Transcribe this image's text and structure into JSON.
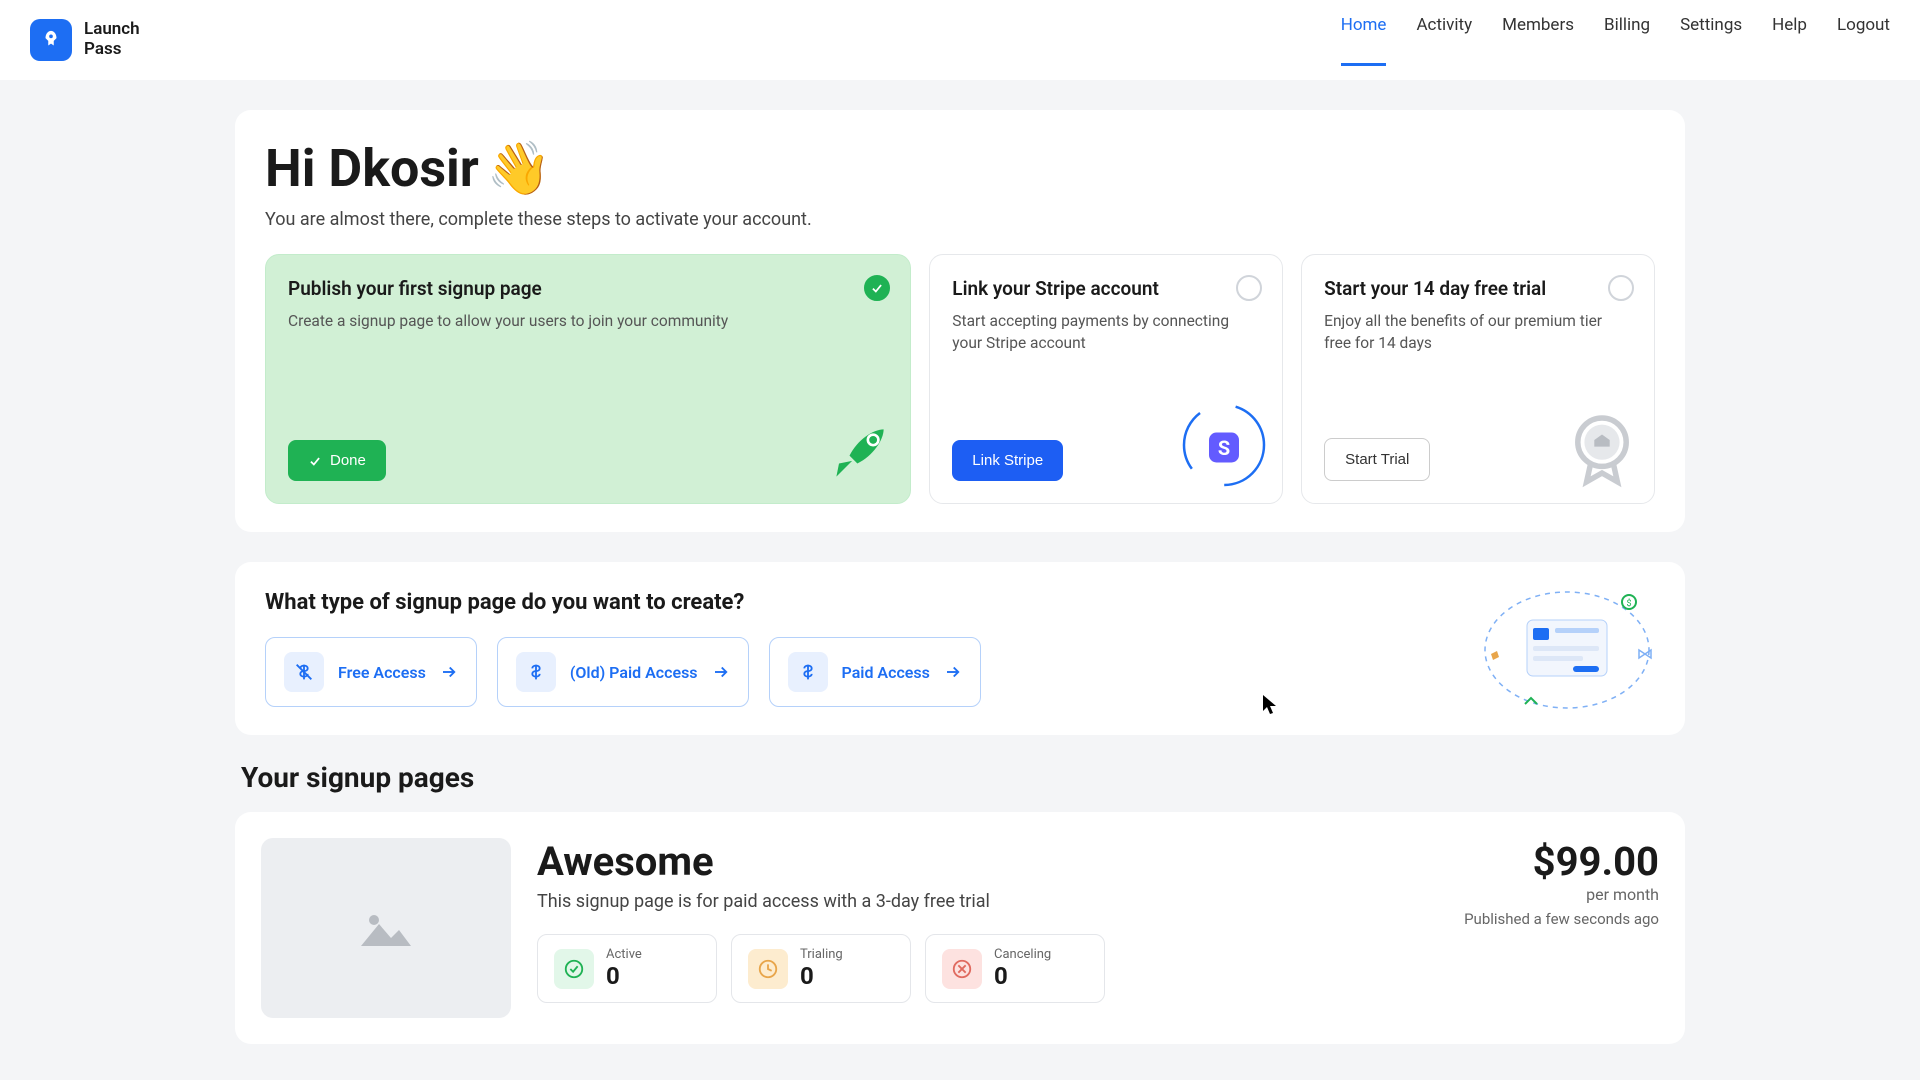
{
  "brand": {
    "line1": "Launch",
    "line2": "Pass"
  },
  "nav": {
    "home": "Home",
    "activity": "Activity",
    "members": "Members",
    "billing": "Billing",
    "settings": "Settings",
    "help": "Help",
    "logout": "Logout"
  },
  "greeting": {
    "title": "Hi Dkosir",
    "emoji": "👋",
    "subtitle": "You are almost there, complete these steps to activate your account."
  },
  "steps": {
    "publish": {
      "title": "Publish your first signup page",
      "desc": "Create a signup page to allow your users to join your community",
      "btn": "Done"
    },
    "stripe": {
      "title": "Link your Stripe account",
      "desc": "Start accepting payments by connecting your Stripe account",
      "btn": "Link Stripe"
    },
    "trial": {
      "title": "Start your 14 day free trial",
      "desc": "Enjoy all the benefits of our premium tier free for 14 days",
      "btn": "Start Trial"
    }
  },
  "create": {
    "heading": "What type of signup page do you want to create?",
    "free": "Free Access",
    "oldpaid": "(Old) Paid Access",
    "paid": "Paid Access"
  },
  "section": {
    "title": "Your signup pages"
  },
  "page1": {
    "title": "Awesome",
    "desc": "This signup page is for paid access with a 3-day free trial",
    "price": "$99.00",
    "per": "per month",
    "published": "Published a few seconds ago",
    "stats": {
      "active": {
        "label": "Active",
        "value": "0"
      },
      "trialing": {
        "label": "Trialing",
        "value": "0"
      },
      "canceling": {
        "label": "Canceling",
        "value": "0"
      }
    }
  }
}
